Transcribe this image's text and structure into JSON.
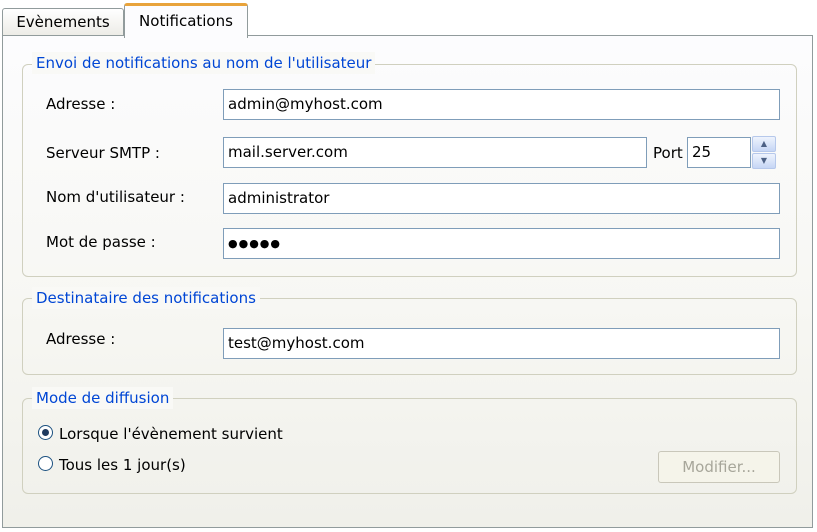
{
  "tabs": [
    {
      "label": "Evènements",
      "active": false
    },
    {
      "label": "Notifications",
      "active": true
    }
  ],
  "sender_group": {
    "title": "Envoi de notifications au nom de l'utilisateur",
    "address_label": "Adresse :",
    "address_value": "admin@myhost.com",
    "smtp_label": "Serveur  SMTP :",
    "smtp_value": "mail.server.com",
    "port_label": "Port :",
    "port_value": "25",
    "username_label": "Nom d'utilisateur :",
    "username_value": "administrator",
    "password_label": "Mot de passe :",
    "password_mask": "●●●●●"
  },
  "recipient_group": {
    "title": "Destinataire des notifications",
    "address_label": "Adresse :",
    "address_value": "test@myhost.com"
  },
  "mode_group": {
    "title": "Mode de diffusion",
    "option_event": "Lorsque l'évènement survient",
    "option_periodic": "Tous les 1 jour(s)",
    "selected": "option_event",
    "modify_button": "Modifier..."
  },
  "colors": {
    "group_title": "#0046d5",
    "active_tab_accent": "#e8a33b",
    "input_border": "#7f9db9"
  }
}
